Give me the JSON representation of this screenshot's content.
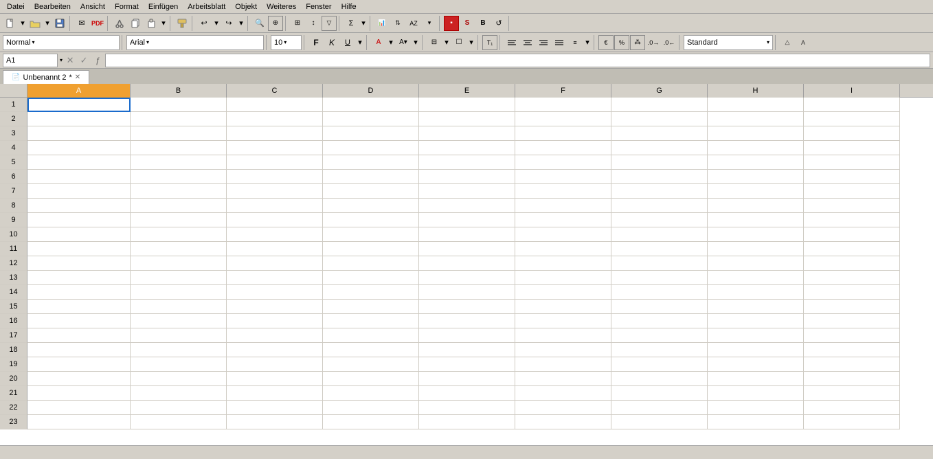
{
  "menubar": {
    "items": [
      "Datei",
      "Bearbeiten",
      "Ansicht",
      "Format",
      "Einfügen",
      "Arbeitsblatt",
      "Objekt",
      "Weiteres",
      "Fenster",
      "Hilfe"
    ]
  },
  "toolbar": {
    "style_label": "Normal",
    "font_label": "Arial",
    "fontsize_label": "10",
    "format_label": "Standard"
  },
  "formulabar": {
    "cell_ref": "A1",
    "formula_text": ""
  },
  "sheet": {
    "tab_label": "Unbenannt 2",
    "tab_modified": "*"
  },
  "columns": [
    "A",
    "B",
    "C",
    "D",
    "E",
    "F",
    "G",
    "H",
    "I"
  ],
  "rows": [
    1,
    2,
    3,
    4,
    5,
    6,
    7,
    8,
    9,
    10,
    11,
    12,
    13,
    14,
    15,
    16,
    17,
    18,
    19,
    20,
    21,
    22,
    23
  ]
}
